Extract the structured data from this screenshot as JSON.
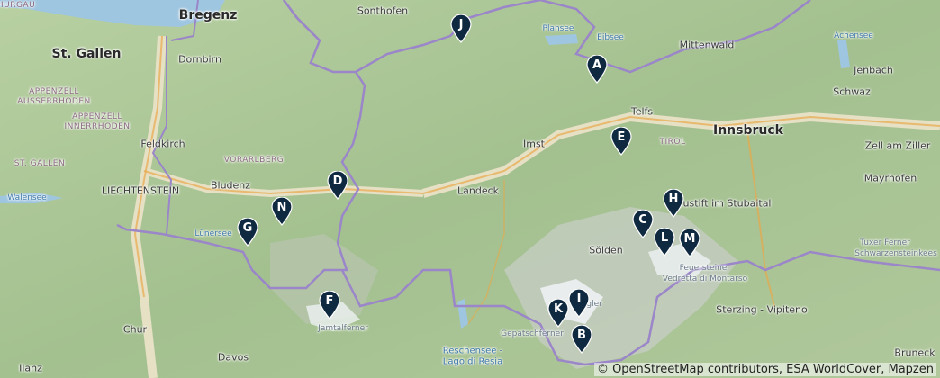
{
  "map": {
    "places": {
      "bregenz": "Bregenz",
      "st_gallen": "St. Gallen",
      "sonthofen": "Sonthofen",
      "dornbirn": "Dornbirn",
      "plansee": "Plansee",
      "eibsee": "Eibsee",
      "mittenwald": "Mittenwald",
      "achensee": "Achensee",
      "jenbach": "Jenbach",
      "schwaz": "Schwaz",
      "appenzell_a": "APPENZELL AUSSERRHODEN",
      "appenzell_i": "APPENZELL INNERRHODEN",
      "hurgau": "HURGAU",
      "telfs": "Telfs",
      "innsbruck": "Innsbruck",
      "feldkirch": "Feldkirch",
      "imst": "Imst",
      "tirol": "TIROL",
      "zell": "Zell am Ziller",
      "st_gallen_region": "ST. GALLEN",
      "vorarlberg": "VORARLBERG",
      "mayrhofen": "Mayrhofen",
      "liechtenstein": "LIECHTENSTEIN",
      "bludenz": "Bludenz",
      "landeck": "Landeck",
      "walensee": "Walensee",
      "neustift": "Neustift im Stubaital",
      "luenersee": "Lünersee",
      "tuxer": "Tuxer Ferner",
      "schwarzenstein": "Schwarzensteinkees",
      "soelden": "Sölden",
      "feuerstein": "Feuersteine",
      "vedretta": "Vedretta di Montarso",
      "jamtalferner": "Jamtalferner",
      "gurgler": "Gurgler",
      "sterzing": "Sterzing - Vipiteno",
      "chur": "Chur",
      "reschensee": "Reschensee -",
      "lago_resia": "Lago di Resia",
      "gepatschferner": "Gepatschferner",
      "davos": "Davos",
      "ilanz": "Ilanz",
      "bruneck": "Bruneck"
    },
    "markers": [
      {
        "label": "J"
      },
      {
        "label": "A"
      },
      {
        "label": "E"
      },
      {
        "label": "D"
      },
      {
        "label": "H"
      },
      {
        "label": "N"
      },
      {
        "label": "C"
      },
      {
        "label": "G"
      },
      {
        "label": "L"
      },
      {
        "label": "M"
      },
      {
        "label": "F"
      },
      {
        "label": "I"
      },
      {
        "label": "K"
      },
      {
        "label": "B"
      }
    ],
    "attribution": "© OpenStreetMap contributors, ESA WorldCover, Mapzen",
    "colors": {
      "marker": "#0f2940",
      "border": "#9a86c8",
      "water": "#9fc6e0",
      "valley": "#e8e2c8"
    }
  }
}
